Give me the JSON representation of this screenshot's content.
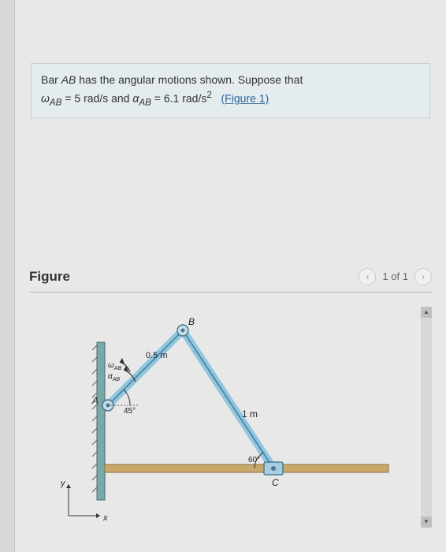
{
  "problem": {
    "line1_prefix": "Bar ",
    "bar_name": "AB",
    "line1_suffix": " has the angular motions shown. Suppose that",
    "omega_sym": "ω",
    "omega_sub": "AB",
    "eq1": " = 5 rad/s and ",
    "alpha_sym": "α",
    "alpha_sub": "AB",
    "eq2": " = 6.1 rad/s",
    "sq": "2",
    "fig_link": "(Figure 1)"
  },
  "figure": {
    "title": "Figure",
    "pager_text": "1 of 1"
  },
  "diagram": {
    "len_AB": "0.5 m",
    "len_BC": "1 m",
    "angle_A": "45°",
    "angle_C": "60°",
    "label_A": "A",
    "label_B": "B",
    "label_C": "C",
    "omega_lbl": "ω",
    "alpha_lbl": "α",
    "sub_AB": "AB",
    "axis_x": "x",
    "axis_y": "y"
  },
  "chart_data": {
    "type": "diagram",
    "description": "Rigid-body kinematics: bar AB pinned at wall point A, length 0.5 m at 45° above horizontal with angular velocity ω_AB=5 rad/s and angular acceleration α_AB=6.1 rad/s²; bar BC length 1 m connects point B to collar C on a horizontal rail; angle at C is 60°.",
    "members": [
      {
        "name": "AB",
        "length_m": 0.5,
        "angle_deg": 45,
        "omega_rad_s": 5,
        "alpha_rad_s2": 6.1
      },
      {
        "name": "BC",
        "length_m": 1.0,
        "angle_at_C_deg": 60
      }
    ],
    "points": [
      "A",
      "B",
      "C"
    ],
    "axes": [
      "x",
      "y"
    ]
  }
}
